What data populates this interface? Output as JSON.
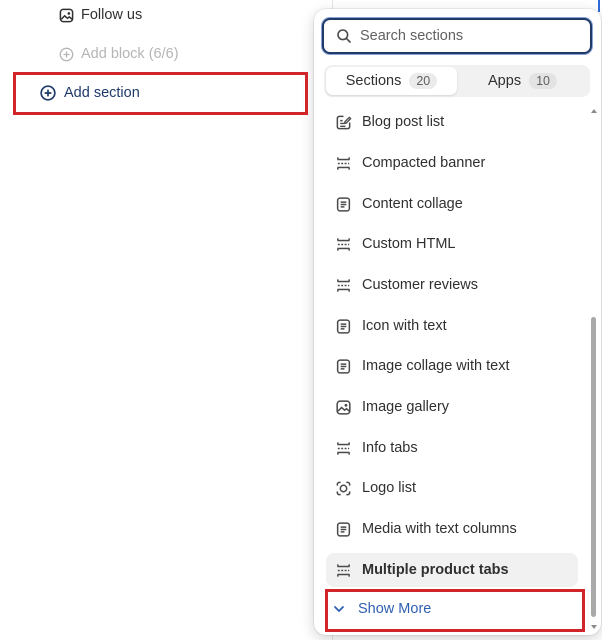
{
  "sidebar": {
    "follow_us_label": "Follow us",
    "add_block_label": "Add block (6/6)",
    "add_section_label": "Add section"
  },
  "popover": {
    "search": {
      "placeholder": "Search sections",
      "value": ""
    },
    "tabs": [
      {
        "label": "Sections",
        "count": "20",
        "active": true
      },
      {
        "label": "Apps",
        "count": "10",
        "active": false
      }
    ],
    "items": [
      {
        "label": "Blog post list",
        "icon": "edit-document-icon"
      },
      {
        "label": "Compacted banner",
        "icon": "section-layout-icon"
      },
      {
        "label": "Content collage",
        "icon": "text-block-icon"
      },
      {
        "label": "Custom HTML",
        "icon": "section-layout-icon"
      },
      {
        "label": "Customer reviews",
        "icon": "section-layout-icon"
      },
      {
        "label": "Icon with text",
        "icon": "text-block-icon"
      },
      {
        "label": "Image collage with text",
        "icon": "text-block-icon"
      },
      {
        "label": "Image gallery",
        "icon": "image-icon"
      },
      {
        "label": "Info tabs",
        "icon": "section-layout-icon"
      },
      {
        "label": "Logo list",
        "icon": "logo-frame-icon"
      },
      {
        "label": "Media with text columns",
        "icon": "text-block-icon"
      },
      {
        "label": "Multiple product tabs",
        "icon": "section-layout-icon",
        "selected": true
      }
    ],
    "show_more_label": "Show More"
  },
  "colors": {
    "highlight": "#d0262a",
    "link": "#2f5fb0",
    "focus_border": "#1f3a68"
  }
}
